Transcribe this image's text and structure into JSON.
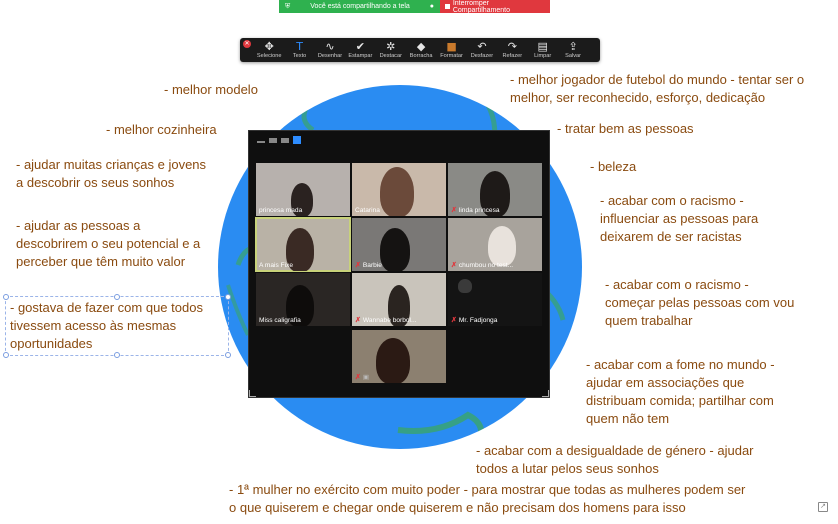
{
  "share_bar": {
    "status": "Você está compartilhando a tela",
    "stop_label": "Interromper Compartilhamento",
    "status_color": "#2fb14f",
    "stop_color": "#e0383e"
  },
  "toolbar": {
    "tools": [
      {
        "icon": "move-icon",
        "glyph": "✥",
        "label": "Selecione"
      },
      {
        "icon": "text-icon",
        "glyph": "T",
        "label": "Texto"
      },
      {
        "icon": "draw-icon",
        "glyph": "∿",
        "label": "Desenhar"
      },
      {
        "icon": "stamp-icon",
        "glyph": "✔",
        "label": "Estampar"
      },
      {
        "icon": "spotlight-icon",
        "glyph": "✲",
        "label": "Destacar"
      },
      {
        "icon": "eraser-icon",
        "glyph": "◆",
        "label": "Borracha"
      },
      {
        "icon": "format-icon",
        "glyph": "■",
        "label": "Formatar"
      },
      {
        "icon": "undo-icon",
        "glyph": "↶",
        "label": "Desfazer"
      },
      {
        "icon": "redo-icon",
        "glyph": "↷",
        "label": "Refazer"
      },
      {
        "icon": "clear-icon",
        "glyph": "🗑",
        "label": "Limpar"
      },
      {
        "icon": "save-icon",
        "glyph": "⇪",
        "label": "Salvar"
      }
    ]
  },
  "gallery": {
    "participants": [
      {
        "name": "princesa mada",
        "muted": false
      },
      {
        "name": "Catarina",
        "muted": false
      },
      {
        "name": "linda princesa",
        "muted": true
      },
      {
        "name": "A mais Fixe",
        "muted": false,
        "speaking": true
      },
      {
        "name": "Barbie",
        "muted": true
      },
      {
        "name": "chumbou no test...",
        "muted": true
      },
      {
        "name": "Miss caligrafia",
        "muted": false
      },
      {
        "name": "Wannabe borbol...",
        "muted": true
      },
      {
        "name": "Mr. Fadjonga",
        "muted": true
      },
      {
        "name": "",
        "muted": true
      }
    ]
  },
  "annotations": {
    "n1": "- melhor modelo",
    "n2": "- melhor cozinheira",
    "n3a": "- ajudar muitas crianças e jovens",
    "n3b": "a descobrir os seus sonhos",
    "n4a": "- ajudar as pessoas a",
    "n4b": "descobrirem o seu potencial e a",
    "n4c": "perceber que têm muito valor",
    "n5a": "- gostava de fazer com que todos",
    "n5b": "tivessem acesso às mesmas",
    "n5c": "oportunidades",
    "n6a": "- melhor jogador de futebol do mundo - tentar ser o",
    "n6b": "melhor, ser reconhecido, esforço, dedicação",
    "n7": "- tratar bem as pessoas",
    "n8": "- beleza",
    "n9a": "- acabar com o racismo -",
    "n9b": "influenciar as pessoas para",
    "n9c": "deixarem de ser racistas",
    "n10a": "- acabar com o racismo -",
    "n10b": "começar pelas pessoas com vou",
    "n10c": "quem trabalhar",
    "n11a": "- acabar com a fome no mundo -",
    "n11b": "ajudar em associações que",
    "n11c": "distribuam comida; partilhar com",
    "n11d": "quem não tem",
    "n12a": "- acabar com a desigualdade de género - ajudar",
    "n12b": "todos a lutar pelos seus sonhos",
    "n13a": "- 1ª mulher no exército com muito poder - para mostrar que todas as mulheres podem ser",
    "n13b": "o que quiserem e chegar onde quiserem e não precisam dos homens para isso"
  },
  "colors": {
    "annotation_text": "#8a4b10",
    "globe": "#2a8cf2",
    "land": "#3aa56a"
  }
}
